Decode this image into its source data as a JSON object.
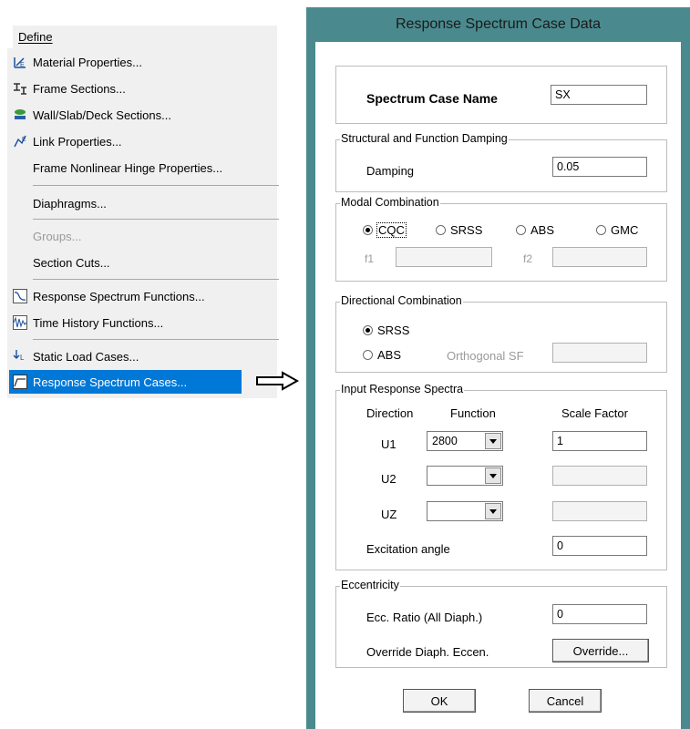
{
  "menu": {
    "title": "Define",
    "items": [
      {
        "label": "Material Properties...",
        "icon": "material-icon"
      },
      {
        "label": "Frame Sections...",
        "icon": "frame-section-icon"
      },
      {
        "label": "Wall/Slab/Deck Sections...",
        "icon": "wall-slab-icon"
      },
      {
        "label": "Link Properties...",
        "icon": "link-icon"
      },
      {
        "label": "Frame Nonlinear Hinge Properties...",
        "icon": ""
      },
      {
        "label": "Diaphragms...",
        "icon": ""
      },
      {
        "label": "Groups...",
        "icon": "",
        "disabled": true
      },
      {
        "label": "Section Cuts...",
        "icon": ""
      },
      {
        "label": "Response Spectrum Functions...",
        "icon": "response-spectrum-function-icon"
      },
      {
        "label": "Time History Functions...",
        "icon": "time-history-icon"
      },
      {
        "label": "Static Load Cases...",
        "icon": "static-load-icon"
      },
      {
        "label": "Response Spectrum Cases...",
        "icon": "response-spectrum-case-icon",
        "selected": true
      }
    ]
  },
  "dialog": {
    "title": "Response Spectrum Case Data",
    "case_name_label": "Spectrum Case Name",
    "case_name_value": "SX",
    "damping_group": "Structural and Function Damping",
    "damping_label": "Damping",
    "damping_value": "0.05",
    "modal_group": "Modal Combination",
    "modal_options": [
      "CQC",
      "SRSS",
      "ABS",
      "GMC"
    ],
    "modal_selected": "CQC",
    "f1_label": "f1",
    "f2_label": "f2",
    "directional_group": "Directional Combination",
    "directional_options": [
      "SRSS",
      "ABS"
    ],
    "directional_selected": "SRSS",
    "orthogonal_label": "Orthogonal SF",
    "input_group": "Input Response Spectra",
    "col_direction": "Direction",
    "col_function": "Function",
    "col_scale": "Scale Factor",
    "rows": [
      {
        "direction": "U1",
        "function": "2800",
        "scale": "1"
      },
      {
        "direction": "U2",
        "function": "",
        "scale": ""
      },
      {
        "direction": "UZ",
        "function": "",
        "scale": ""
      }
    ],
    "excitation_label": "Excitation  angle",
    "excitation_value": "0",
    "ecc_group": "Eccentricity",
    "ecc_ratio_label": "Ecc. Ratio (All Diaph.)",
    "ecc_ratio_value": "0",
    "override_label": "Override Diaph. Eccen.",
    "override_button": "Override...",
    "ok_button": "OK",
    "cancel_button": "Cancel"
  }
}
